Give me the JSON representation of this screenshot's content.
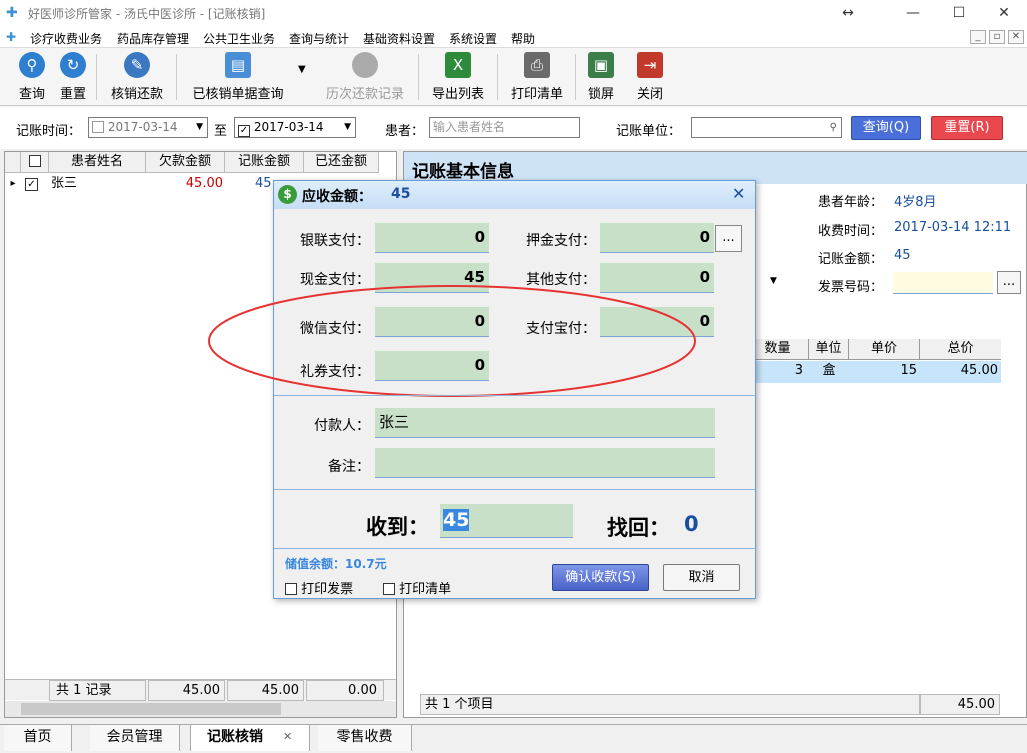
{
  "window": {
    "title": "好医师诊所管家 - 汤氏中医诊所 - [记账核销]",
    "resize_glyph": "↔",
    "minimize": "—",
    "maximize": "☐",
    "close": "✕"
  },
  "menu": {
    "items": [
      "诊疗收费业务",
      "药品库存管理",
      "公共卫生业务",
      "查询与统计",
      "基础资料设置",
      "系统设置",
      "帮助"
    ],
    "mdi": [
      "_",
      "▫",
      "✕"
    ]
  },
  "toolbar": {
    "buttons": [
      {
        "label": "查询",
        "icon": "search-icon",
        "color": "#2f7fd0"
      },
      {
        "label": "重置",
        "icon": "refresh-icon",
        "color": "#2f7fd0"
      },
      {
        "label": "核销还款",
        "icon": "writeoff-icon",
        "color": "#3a78c2"
      },
      {
        "label": "已核销单据查询",
        "icon": "document-search-icon",
        "color": "#4a8fd6"
      },
      {
        "label": "历次还款记录",
        "icon": "history-icon",
        "color": "#aaaaaa"
      },
      {
        "label": "导出列表",
        "icon": "excel-icon",
        "color": "#2e8b3c"
      },
      {
        "label": "打印清单",
        "icon": "printer-icon",
        "color": "#6a6a6a"
      },
      {
        "label": "锁屏",
        "icon": "lock-screen-icon",
        "color": "#3c7d4a"
      },
      {
        "label": "关闭",
        "icon": "exit-icon",
        "color": "#c0392b"
      }
    ],
    "dropdown": "▼"
  },
  "filter": {
    "date_label": "记账时间：",
    "date_from": "2017-03-14",
    "to_label": "至",
    "date_to": "2017-03-14",
    "patient_label": "患者：",
    "patient_placeholder": "输入患者姓名",
    "unit_label": "记账单位：",
    "search_btn": "查询(Q)",
    "reset_btn": "重置(R)",
    "arrow": "▼",
    "search_glyph": "⚲"
  },
  "grid": {
    "headers": [
      "患者姓名",
      "欠款金额",
      "记账金额",
      "已还金额"
    ],
    "rows": [
      {
        "name": "张三",
        "owed": "45.00",
        "amount": "45"
      }
    ],
    "footer": {
      "count": "共 1 记录",
      "owed": "45.00",
      "amount": "45.00",
      "paid": "0.00"
    },
    "row_marker": "▸",
    "check": "✓"
  },
  "right_panel": {
    "heading": "记账基本信息",
    "age_label": "患者年龄：",
    "age": "4岁8月",
    "time_label": "收费时间：",
    "time": "2017-03-14 12:11",
    "amount_label": "记账金额：",
    "amount": "45",
    "invoice_label": "发票号码：",
    "ellipsis": "...",
    "arrow": "▼",
    "table_headers": [
      "数量",
      "单位",
      "单价",
      "总价"
    ],
    "table_row": {
      "qty": "3",
      "unit": "盒",
      "price": "15",
      "total": "45.00"
    },
    "footer_count": "共 1 个项目",
    "footer_total": "45.00"
  },
  "dialog": {
    "title": "应收金额：",
    "title_value": "45",
    "close": "✕",
    "unionpay_label": "银联支付：",
    "unionpay": "0",
    "deposit_label": "押金支付：",
    "deposit": "0",
    "cash_label": "现金支付：",
    "cash": "45",
    "other_label": "其他支付：",
    "other": "0",
    "wechat_label": "微信支付：",
    "wechat": "0",
    "alipay_label": "支付宝付：",
    "alipay": "0",
    "coupon_label": "礼券支付：",
    "coupon": "0",
    "payer_label": "付款人：",
    "payer": "张三",
    "remark_label": "备注：",
    "remark": "",
    "received_label": "收到：",
    "received": "45",
    "change_label": "找回：",
    "change": "0",
    "balance": "储值余额：10.7元",
    "print_invoice": "打印发票",
    "print_list": "打印清单",
    "confirm_btn": "确认收款(S)",
    "cancel_btn": "取消",
    "ellipsis": "...",
    "coin": "$"
  },
  "tabs": {
    "items": [
      "首页",
      "会员管理",
      "记账核销",
      "零售收费"
    ],
    "close": "✕"
  },
  "colors": {
    "accent": "#1a4fa0",
    "red": "#cc0000",
    "highlight": "#c7e5fa"
  }
}
